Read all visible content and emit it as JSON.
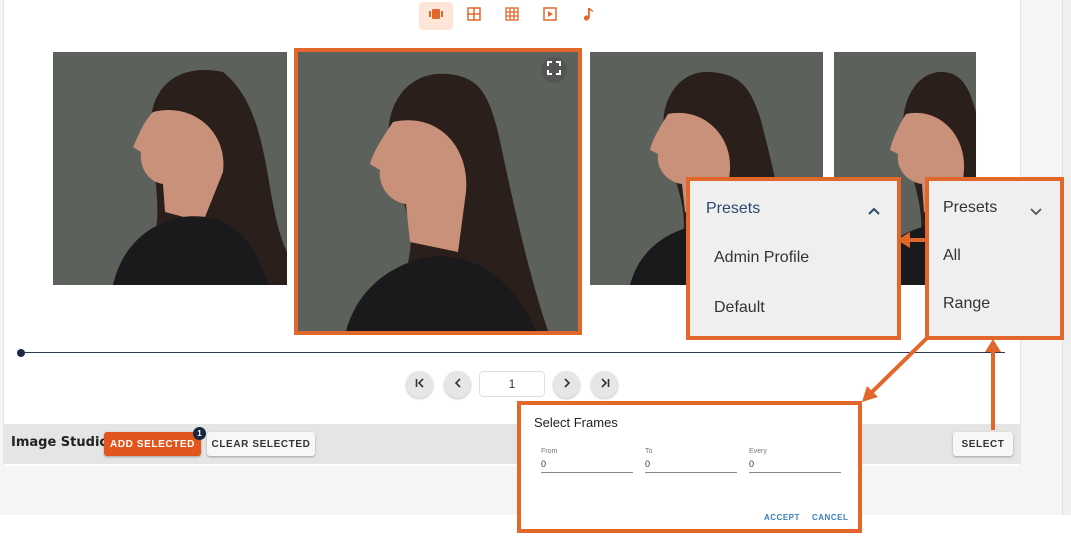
{
  "toolbar": {
    "views": [
      {
        "icon": "filmstrip-icon",
        "active": true
      },
      {
        "icon": "grid-small-icon",
        "active": false
      },
      {
        "icon": "grid-large-icon",
        "active": false
      },
      {
        "icon": "play-icon",
        "active": false
      },
      {
        "icon": "music-note-icon",
        "active": false
      }
    ]
  },
  "photos": [
    {
      "name": "photo-1",
      "selected": false
    },
    {
      "name": "photo-2",
      "selected": true
    },
    {
      "name": "photo-3",
      "selected": false
    },
    {
      "name": "photo-4",
      "selected": false
    }
  ],
  "pager": {
    "page": "1",
    "icons": [
      "first-page-icon",
      "previous-icon",
      "next-icon",
      "last-page-icon"
    ]
  },
  "studio": {
    "label": "Image Studio:",
    "add_selected": "ADD SELECTED",
    "badge_count": "1",
    "clear_selected": "CLEAR SELECTED",
    "select": "SELECT"
  },
  "presets_open": {
    "title": "Presets",
    "items": [
      "Admin Profile",
      "Default"
    ]
  },
  "presets_closed": {
    "title": "Presets",
    "items": [
      "All",
      "Range"
    ]
  },
  "select_frames": {
    "title": "Select Frames",
    "fields": [
      {
        "label": "From",
        "value": "0"
      },
      {
        "label": "To",
        "value": "0"
      },
      {
        "label": "Every",
        "value": "0"
      }
    ],
    "accept": "ACCEPT",
    "cancel": "CANCEL"
  },
  "colors": {
    "accent": "#e2672a",
    "primary_button": "#e2561d",
    "link": "#3a7fc1",
    "timeline": "#2e3b55"
  }
}
